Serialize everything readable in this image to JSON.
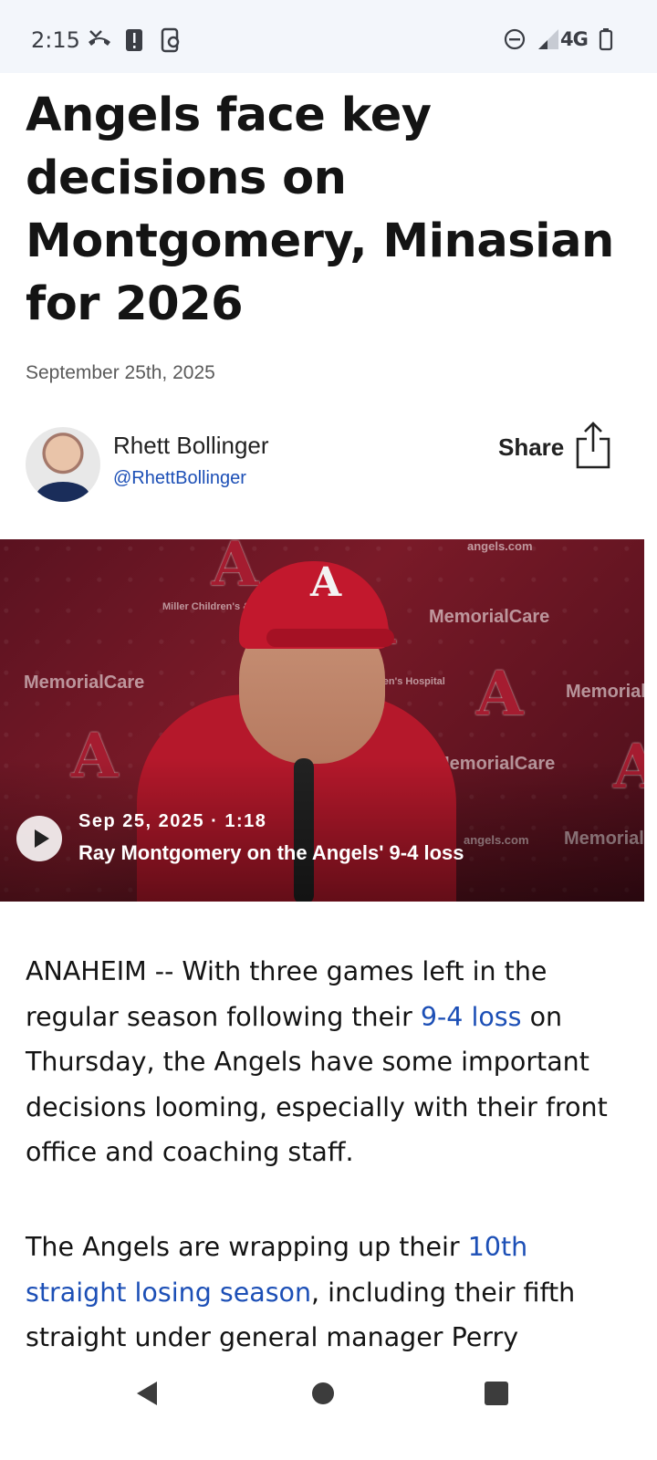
{
  "status_bar": {
    "time": "2:15",
    "left_icons": [
      "missed-call-icon",
      "alert-icon",
      "data-sync-icon"
    ],
    "right_icons": [
      "do-not-disturb-icon",
      "signal-icon",
      "battery-icon"
    ],
    "network": "4G"
  },
  "article": {
    "title": "Angels face key decisions on Montgomery, Minasian for 2026",
    "date": "September 25th, 2025",
    "author": {
      "name": "Rhett Bollinger",
      "handle": "@RhettBollinger"
    },
    "share_label": "Share"
  },
  "video": {
    "meta": "Sep 25, 2025 · 1:18",
    "title": "Ray Montgomery on the Angels' 9-4 loss",
    "background_text": {
      "sponsor": "MemorialCare",
      "sponsor2": "Miller Children's & Women's Hospital",
      "site": "angels.com",
      "partial_left": "Memorial",
      "childrens": "Children's Hospital"
    }
  },
  "body": {
    "p1": {
      "before": "ANAHEIM -- With three games left in the regular season following their ",
      "link": "9-4 loss",
      "after": " on Thursday, the Angels have some important decisions looming, especially with their front office and coaching staff."
    },
    "p2": {
      "before": "The Angels are wrapping up their ",
      "link": "10th straight losing season",
      "after": ", including their fifth straight under general manager Perry"
    }
  },
  "nav": {
    "back": "back-icon",
    "home": "home-icon",
    "recents": "recents-icon"
  },
  "colors": {
    "link": "#1c4fb6",
    "status_bar_bg": "#f3f6fb",
    "angels_red": "#ba0021"
  }
}
